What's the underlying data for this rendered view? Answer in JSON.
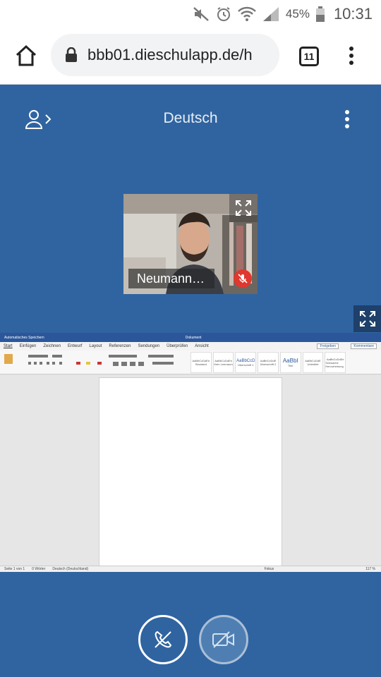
{
  "status_bar": {
    "battery_percent": "45%",
    "time": "10:31",
    "icons": [
      "mute-icon",
      "alarm-icon",
      "wifi-icon",
      "signal-icon",
      "battery-icon"
    ]
  },
  "browser": {
    "url": "bbb01.dieschulapp.de/h",
    "tab_count": "11",
    "icons": [
      "home-icon",
      "lock-icon",
      "tabs-icon",
      "more-vert-icon"
    ]
  },
  "meeting": {
    "title": "Deutsch",
    "background_color": "#2f64a0",
    "webcam": {
      "participant_name": "Neumann…",
      "muted": true,
      "muted_color": "#e0372e"
    },
    "controls": [
      "leave-audio-button",
      "share-camera-button"
    ]
  },
  "screenshare": {
    "app_title_left": "Automatisches Speichern",
    "app_title_center": "Dokument",
    "menu_items": [
      "Start",
      "Einfügen",
      "Zeichnen",
      "Entwurf",
      "Layout",
      "Referenzen",
      "Sendungen",
      "Überprüfen",
      "Ansicht"
    ],
    "share_label": "Freigeben",
    "comments_label": "Kommentare",
    "styles": [
      {
        "sample": "AaBbCcDdEe",
        "name": "Standard"
      },
      {
        "sample": "AaBbCcDdEe",
        "name": "Kein Leerraum"
      },
      {
        "sample": "AaBbCcD",
        "name": "Überschrift 1"
      },
      {
        "sample": "AaBbCcDdE",
        "name": "Überschrift 2"
      },
      {
        "sample": "AaBbI",
        "name": "Titel"
      },
      {
        "sample": "AaBbCcDdE",
        "name": "Untertitel"
      },
      {
        "sample": "AaBbCcDdEe",
        "name": "Schwache Hervorhebung"
      }
    ],
    "status_text": [
      "Seite 1 von 1",
      "0 Wörter",
      "Deutsch (Deutschland)"
    ],
    "zoom": "117 %",
    "focus_label": "Fokus"
  }
}
